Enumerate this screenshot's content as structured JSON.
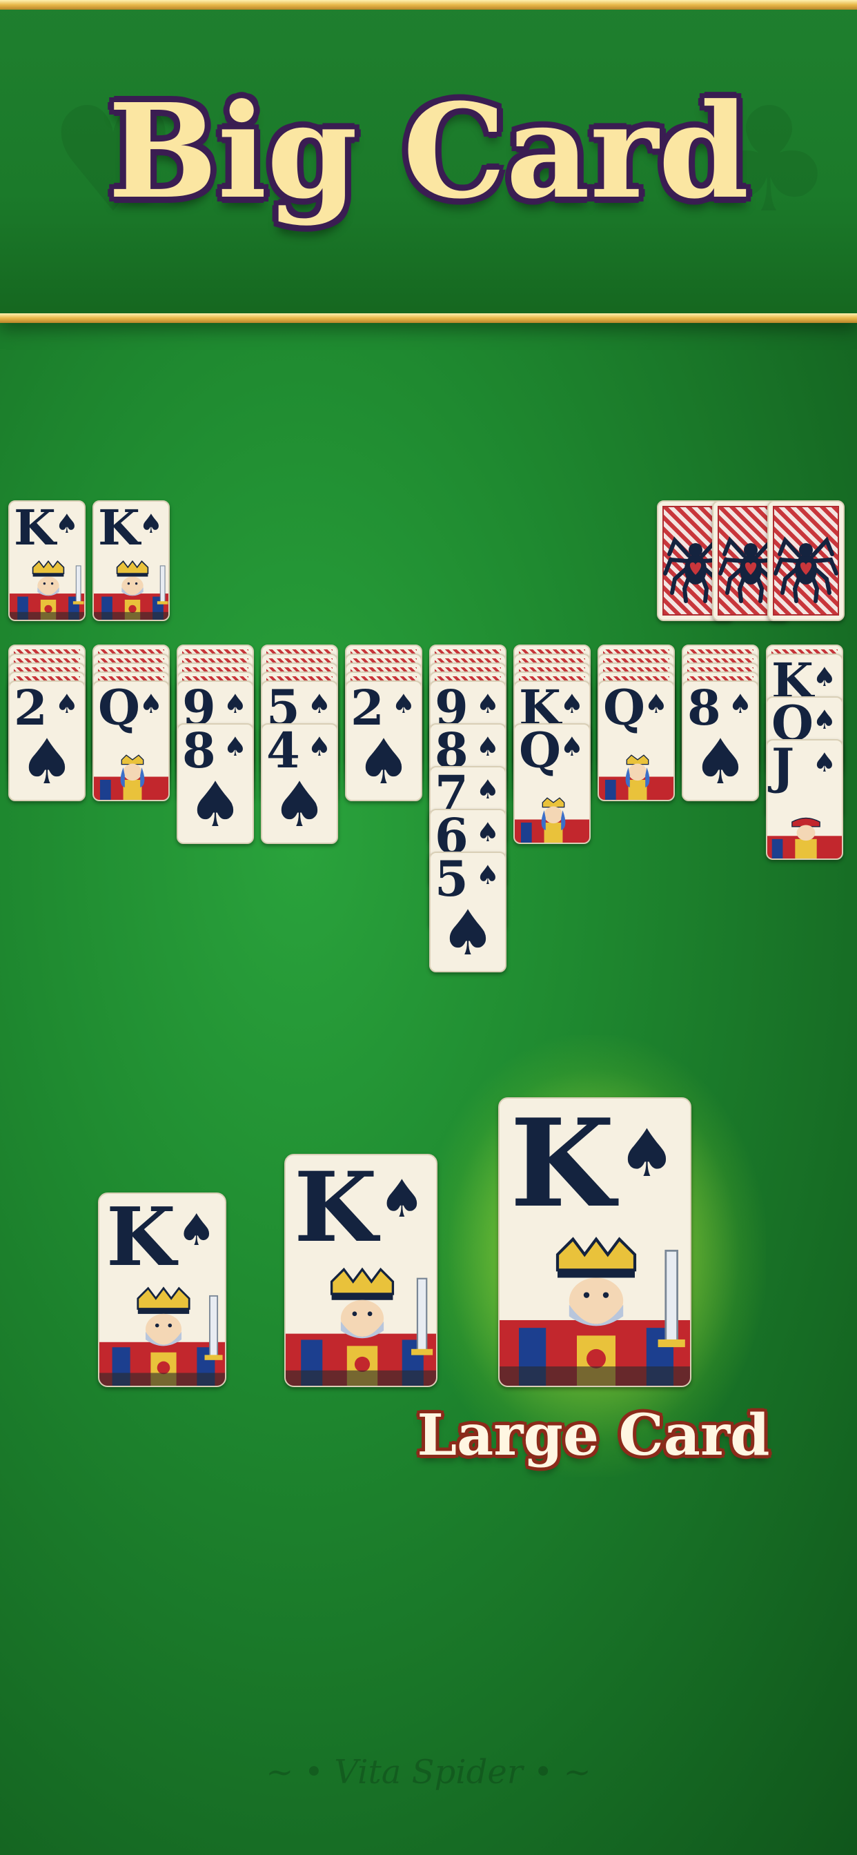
{
  "banner": {
    "title": "Big Card"
  },
  "colors": {
    "felt": "#1f8a30",
    "card": "#f6f0e1",
    "ink": "#14233f",
    "back_red": "#c8363b",
    "gold": "#e8b84a"
  },
  "foundations": [
    {
      "rank": "K",
      "suit": "♠"
    },
    {
      "rank": "K",
      "suit": "♠"
    }
  ],
  "stock": {
    "count": 3,
    "icon": "spider-icon"
  },
  "tableau": [
    {
      "facedown": 4,
      "cards": [
        {
          "rank": "2",
          "suit": "♠"
        }
      ]
    },
    {
      "facedown": 4,
      "cards": [
        {
          "rank": "Q",
          "suit": "♠"
        }
      ]
    },
    {
      "facedown": 4,
      "cards": [
        {
          "rank": "9",
          "suit": "♠"
        },
        {
          "rank": "8",
          "suit": "♠"
        }
      ]
    },
    {
      "facedown": 4,
      "cards": [
        {
          "rank": "5",
          "suit": "♠"
        },
        {
          "rank": "4",
          "suit": "♠"
        }
      ]
    },
    {
      "facedown": 4,
      "cards": [
        {
          "rank": "2",
          "suit": "♠"
        }
      ]
    },
    {
      "facedown": 4,
      "cards": [
        {
          "rank": "9",
          "suit": "♠"
        },
        {
          "rank": "8",
          "suit": "♠"
        },
        {
          "rank": "7",
          "suit": "♠"
        },
        {
          "rank": "6",
          "suit": "♠"
        },
        {
          "rank": "5",
          "suit": "♠"
        }
      ]
    },
    {
      "facedown": 4,
      "cards": [
        {
          "rank": "K",
          "suit": "♠"
        },
        {
          "rank": "Q",
          "suit": "♠"
        }
      ]
    },
    {
      "facedown": 4,
      "cards": [
        {
          "rank": "Q",
          "suit": "♠"
        }
      ]
    },
    {
      "facedown": 4,
      "cards": [
        {
          "rank": "8",
          "suit": "♠"
        }
      ]
    },
    {
      "facedown": 1,
      "cards": [
        {
          "rank": "K",
          "suit": "♠"
        },
        {
          "rank": "Q",
          "suit": "♠"
        },
        {
          "rank": "J",
          "suit": "♠"
        }
      ]
    }
  ],
  "showcase": {
    "cards": [
      {
        "rank": "K",
        "suit": "♠",
        "size": "small"
      },
      {
        "rank": "K",
        "suit": "♠",
        "size": "medium"
      },
      {
        "rank": "K",
        "suit": "♠",
        "size": "large"
      }
    ],
    "label": "Large Card"
  },
  "footer": {
    "brand": "Vita Spider"
  }
}
